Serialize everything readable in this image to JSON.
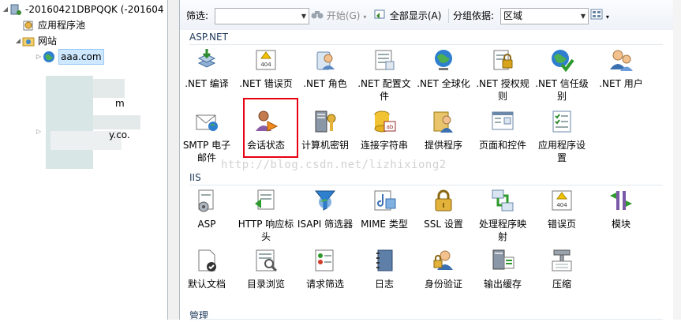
{
  "tree": {
    "server": "-20160421DBPQQK (-201604",
    "app_pools": "应用程序池",
    "sites": "网站",
    "site": "aaa.com",
    "blur1": "m",
    "blur2": "y.co."
  },
  "toolbar": {
    "filter_label": "筛选:",
    "filter_value": "",
    "start_label": "开始(G)",
    "show_all_label": "全部显示(A)",
    "group_label": "分组依据:",
    "group_value": "区域"
  },
  "sections": {
    "aspnet": "ASP.NET",
    "iis": "IIS",
    "manage": "管理"
  },
  "aspnet": [
    {
      "line1": ".NET 编译",
      "line2": ""
    },
    {
      "line1": ".NET 错误页",
      "line2": ""
    },
    {
      "line1": ".NET 角色",
      "line2": ""
    },
    {
      "line1": ".NET 配置文",
      "line2": "件"
    },
    {
      "line1": ".NET 全球化",
      "line2": ""
    },
    {
      "line1": ".NET 授权规",
      "line2": "则"
    },
    {
      "line1": ".NET 信任级",
      "line2": "别"
    },
    {
      "line1": ".NET 用户",
      "line2": ""
    },
    {
      "line1": "SMTP 电子",
      "line2": "邮件"
    },
    {
      "line1": "会话状态",
      "line2": ""
    },
    {
      "line1": "计算机密钥",
      "line2": ""
    },
    {
      "line1": "连接字符串",
      "line2": ""
    },
    {
      "line1": "提供程序",
      "line2": ""
    },
    {
      "line1": "页面和控件",
      "line2": ""
    },
    {
      "line1": "应用程序设",
      "line2": "置"
    }
  ],
  "iis": [
    {
      "line1": "ASP",
      "line2": ""
    },
    {
      "line1": "HTTP 响应标",
      "line2": "头"
    },
    {
      "line1": "ISAPI 筛选器",
      "line2": ""
    },
    {
      "line1": "MIME 类型",
      "line2": ""
    },
    {
      "line1": "SSL 设置",
      "line2": ""
    },
    {
      "line1": "处理程序映",
      "line2": "射"
    },
    {
      "line1": "错误页",
      "line2": ""
    },
    {
      "line1": "模块",
      "line2": ""
    },
    {
      "line1": "默认文档",
      "line2": ""
    },
    {
      "line1": "目录浏览",
      "line2": ""
    },
    {
      "line1": "请求筛选",
      "line2": ""
    },
    {
      "line1": "日志",
      "line2": ""
    },
    {
      "line1": "身份验证",
      "line2": ""
    },
    {
      "line1": "输出缓存",
      "line2": ""
    },
    {
      "line1": "压缩",
      "line2": ""
    }
  ],
  "icon_text": {
    "error404": "404"
  },
  "watermark": "http://blog.csdn.net/lizhixiong2",
  "colors": {
    "highlight_border": "#e60012",
    "section_text": "#1e395b",
    "selection": "#cde8ff"
  }
}
